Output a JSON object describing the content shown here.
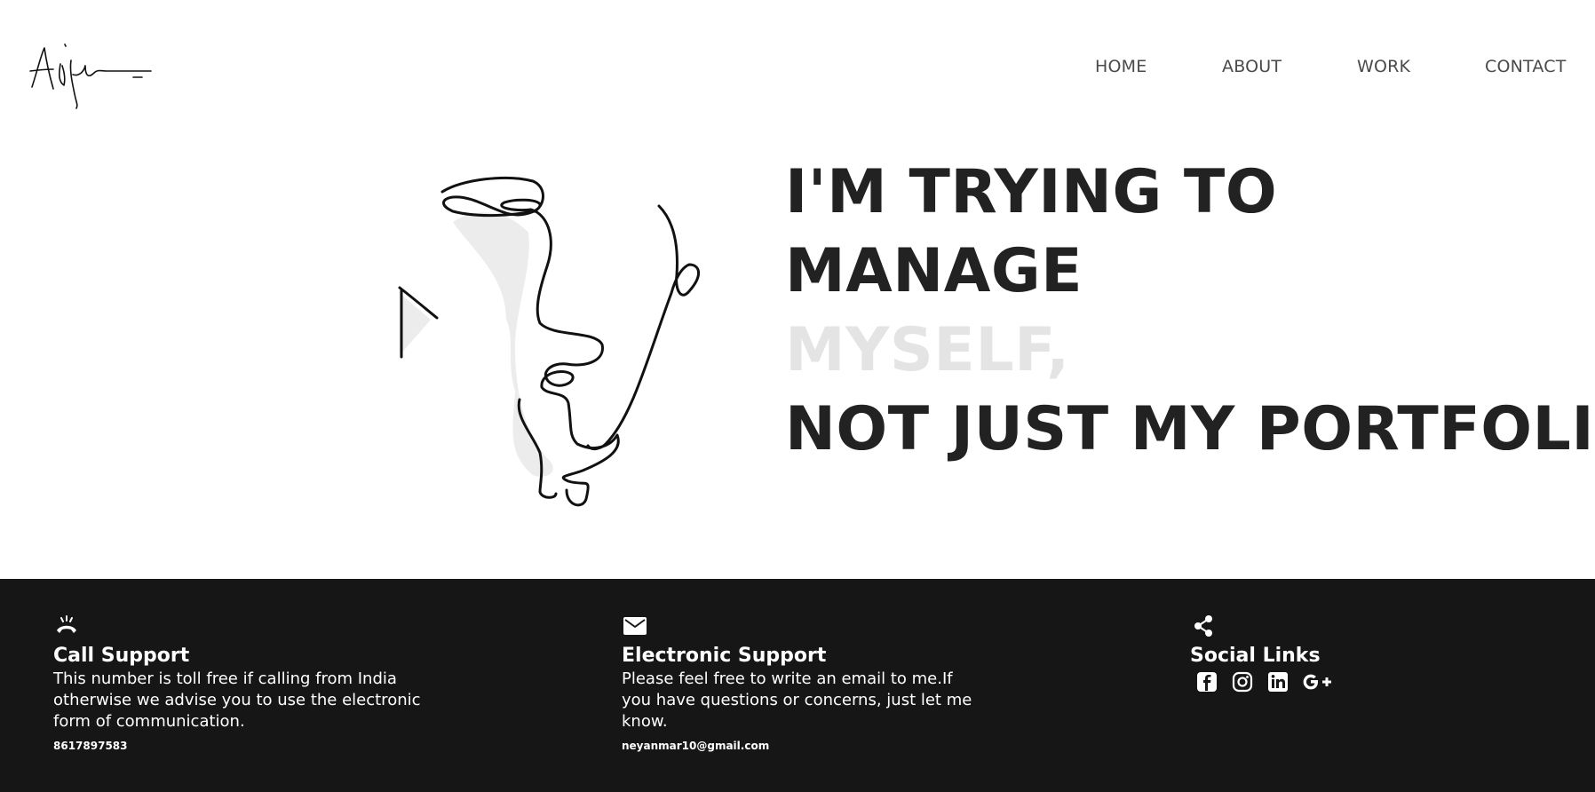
{
  "header": {
    "nav": [
      {
        "label": "HOME"
      },
      {
        "label": "ABOUT"
      },
      {
        "label": "WORK"
      },
      {
        "label": "CONTACT"
      }
    ]
  },
  "hero": {
    "line1": "I'M TRYING TO",
    "line2": "MANAGE",
    "line3": "MYSELF,",
    "line4": "NOT JUST MY PORTFOLIO."
  },
  "footer": {
    "call": {
      "icon": "phone-icon",
      "title": "Call Support",
      "text": "This number is toll free if calling from India otherwise we advise you to use the electronic form of communication.",
      "phone": "8617897583"
    },
    "email": {
      "icon": "mail-icon",
      "title": "Electronic Support",
      "text": "Please feel free to write an email to me.If you have questions or concerns, just let me know.",
      "address": "neyanmar10@gmail.com"
    },
    "social": {
      "icon": "share-icon",
      "title": "Social Links",
      "links": [
        "facebook-icon",
        "instagram-icon",
        "linkedin-icon",
        "google-plus-icon"
      ]
    }
  },
  "colors": {
    "text_dark": "#222222",
    "text_faded": "#e4e4e4",
    "nav": "#4a4a4a",
    "footer_bg": "#161616"
  }
}
